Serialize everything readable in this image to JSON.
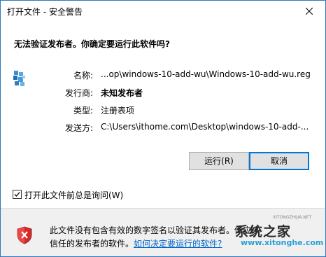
{
  "window": {
    "title": "打开文件 - 安全警告"
  },
  "dialog": {
    "headline": "无法验证发布者。你确定要运行此软件吗?",
    "file_icon": "registry-file-icon",
    "info": [
      {
        "label": "名称:",
        "value": "...op\\windows-10-add-wu\\Windows-10-add-wu.reg"
      },
      {
        "label": "发行商:",
        "value": "未知发布者"
      },
      {
        "label": "类型:",
        "value": "注册表项"
      },
      {
        "label": "发送方:",
        "value": "C:\\Users\\ithome.com\\Desktop\\windows-10-add-..."
      }
    ]
  },
  "buttons": {
    "run": "运行(R)",
    "cancel": "取消"
  },
  "checkbox": {
    "label": "打开此文件前总是询问(W)",
    "checked": true
  },
  "footer": {
    "icon": "shield-error-icon",
    "line1": "此文件没有包含有效的数字签名以验证其发布者。你应该",
    "line2_prefix": "信任的发布者的软件。",
    "link": "如何决定要运行的软件?"
  },
  "watermark": {
    "brand": "系统之家",
    "small": "XITONGZHIJIA.NET",
    "site": "www.xitonghe.com"
  },
  "colors": {
    "window_border": "#2b79c2",
    "link": "#0066cc",
    "default_button_border": "#0078d7",
    "footer_bg": "#f0f0f0"
  }
}
